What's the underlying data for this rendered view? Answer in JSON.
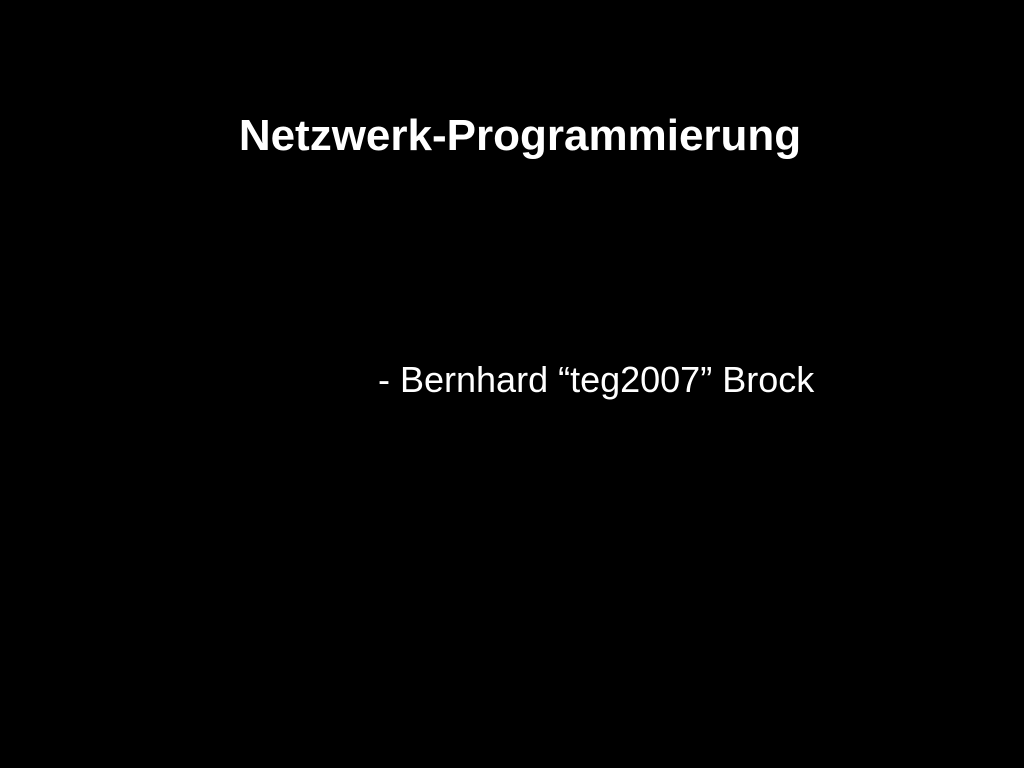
{
  "slide": {
    "background_color": "#000000",
    "text_color": "#ffffff",
    "title": "Netzwerk-Programmierung",
    "subtitle": "- Bernhard “teg2007” Brock"
  }
}
